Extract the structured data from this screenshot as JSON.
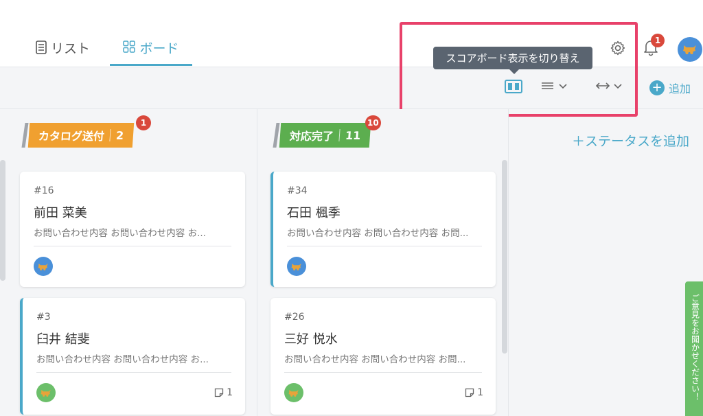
{
  "tabs": {
    "list_label": "リスト",
    "board_label": "ボード"
  },
  "header": {
    "notification_count": "1"
  },
  "tooltip": {
    "text": "スコアボード表示を切り替え"
  },
  "toolbar": {
    "add_label": "追加"
  },
  "columns": [
    {
      "title": "カタログ送付",
      "count": "2",
      "badge": "1",
      "color": "#f0a030",
      "cards": [
        {
          "number": "#16",
          "name": "前田 菜美",
          "desc": "お問い合わせ内容 お問い合わせ内容 お...",
          "avatar_color": "#4a90d9",
          "comments": ""
        },
        {
          "number": "#3",
          "name": "臼井 結斐",
          "desc": "お問い合わせ内容 お問い合わせ内容 お...",
          "avatar_color": "#6cbf6a",
          "comments": "1"
        }
      ]
    },
    {
      "title": "対応完了",
      "count": "11",
      "badge": "10",
      "color": "#5cae4f",
      "cards": [
        {
          "number": "#34",
          "name": "石田 楓季",
          "desc": "お問い合わせ内容 お問い合わせ内容 お問...",
          "avatar_color": "#4a90d9",
          "comments": ""
        },
        {
          "number": "#26",
          "name": "三好 悦水",
          "desc": "お問い合わせ内容 お問い合わせ内容 お問...",
          "avatar_color": "#6cbf6a",
          "comments": "1"
        }
      ]
    }
  ],
  "add_status_label": "＋ステータスを追加",
  "feedback_label": "ご意見をお聞かせください！",
  "colors": {
    "accent": "#4aa8c9",
    "badge": "#d9483b",
    "highlight": "#e8416a",
    "tooltip_bg": "#5a6470"
  }
}
